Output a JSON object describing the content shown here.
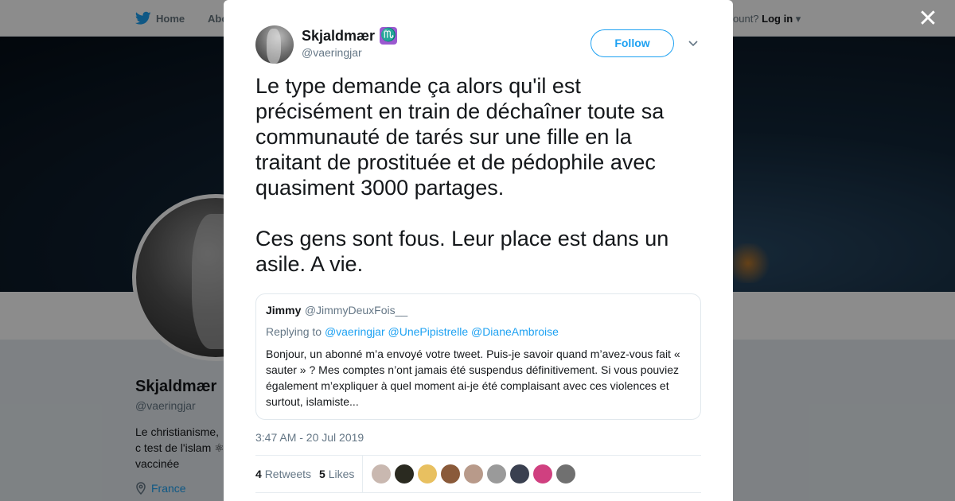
{
  "topnav": {
    "home_label": "Home",
    "about_label": "Abo",
    "login_prefix": "ccount?",
    "login_label": "Log in"
  },
  "profile": {
    "name": "Skjaldmær",
    "handle": "@vaeringjar",
    "bio": "Le christianisme, c test de l'islam ⚛ vaccinée",
    "location": "France"
  },
  "tweet": {
    "author_name": "Skjaldmær",
    "author_badge": "♏",
    "author_handle": "@vaeringjar",
    "follow_label": "Follow",
    "text": "Le type demande ça alors qu'il est précisément en train de déchaîner toute sa communauté de tarés sur une fille en la traitant de prostituée et de pédophile avec quasiment 3000 partages.\n\nCes gens sont fous. Leur place est dans un asile. A vie.",
    "timestamp": "3:47 AM - 20 Jul 2019",
    "retweets_count": "4",
    "retweets_label": "Retweets",
    "likes_count": "5",
    "likes_label": "Likes"
  },
  "quoted": {
    "name": "Jimmy",
    "handle": "@JimmyDeuxFois__",
    "replying_prefix": "Replying to",
    "replying_to": "@vaeringjar @UnePipistrelle @DianeAmbroise",
    "text": "Bonjour, un abonné m’a envoyé votre tweet. Puis-je savoir quand m’avez-vous fait « sauter » ? Mes comptes n’ont jamais été suspendus définitivement. Si vous pouviez également m’expliquer à quel moment ai-je été complaisant avec ces violences et surtout, islamiste..."
  },
  "likers": [
    "#c9b8b0",
    "#2a2a20",
    "#e8c060",
    "#8a5a3a",
    "#b89a8a",
    "#9a9a9a",
    "#3a4050",
    "#d04080",
    "#707070"
  ],
  "colors": {
    "accent": "#1da1f2",
    "muted": "#657786",
    "text": "#14171a"
  }
}
